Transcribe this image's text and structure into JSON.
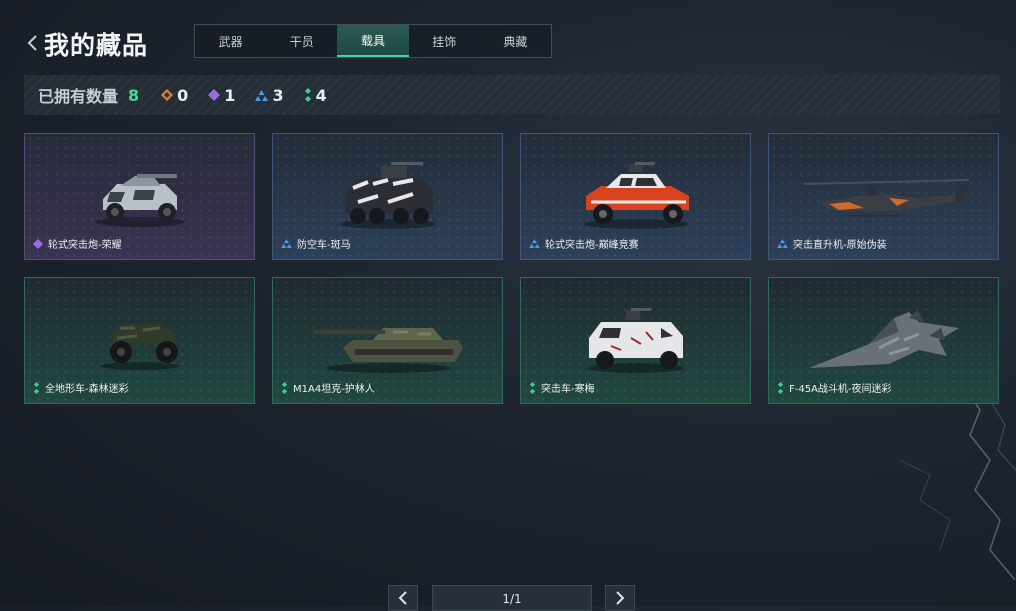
{
  "header": {
    "title": "我的藏品"
  },
  "tabs": [
    {
      "label": "武器",
      "active": false
    },
    {
      "label": "干员",
      "active": false
    },
    {
      "label": "载具",
      "active": true
    },
    {
      "label": "挂饰",
      "active": false
    },
    {
      "label": "典藏",
      "active": false
    }
  ],
  "stats": {
    "label": "已拥有数量",
    "total": "8",
    "rarities": [
      {
        "icon": "orange-diamond-icon",
        "color": "#d9823b",
        "count": "0"
      },
      {
        "icon": "purple-diamond-icon",
        "color": "#9a6ee0",
        "count": "1"
      },
      {
        "icon": "blue-triangle-icon",
        "color": "#4f9be8",
        "count": "3"
      },
      {
        "icon": "green-dots-icon",
        "color": "#3fcf9a",
        "count": "4"
      }
    ]
  },
  "items": [
    {
      "label": "轮式突击炮-荣耀",
      "rarity": "purple",
      "vehicle": "wheeled-assault-gun"
    },
    {
      "label": "防空车-斑马",
      "rarity": "blue",
      "vehicle": "anti-air-vehicle"
    },
    {
      "label": "轮式突击炮-巅峰竞赛",
      "rarity": "blue",
      "vehicle": "wheeled-assault-gun"
    },
    {
      "label": "突击直升机-原始伪装",
      "rarity": "blue",
      "vehicle": "attack-helicopter"
    },
    {
      "label": "全地形车-森林迷彩",
      "rarity": "green",
      "vehicle": "atv"
    },
    {
      "label": "M1A4坦克-护林人",
      "rarity": "green",
      "vehicle": "tank"
    },
    {
      "label": "突击车-寒梅",
      "rarity": "green",
      "vehicle": "assault-vehicle"
    },
    {
      "label": "F-45A战斗机-夜间迷彩",
      "rarity": "green",
      "vehicle": "fighter-jet"
    }
  ],
  "pagination": {
    "indicator": "1/1"
  },
  "colors": {
    "accent_green": "#3fe08f",
    "tab_active": "#2b5a52"
  }
}
